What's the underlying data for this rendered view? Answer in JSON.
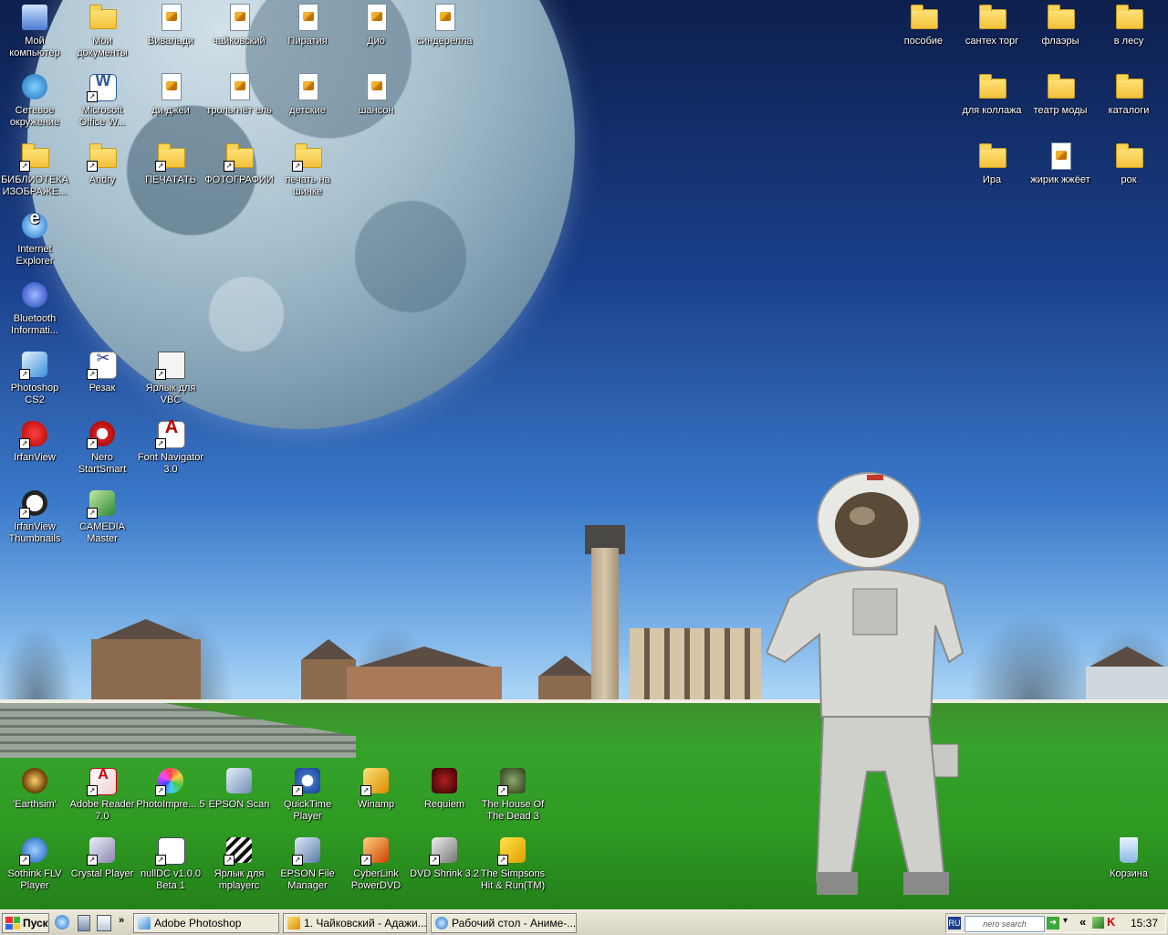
{
  "desktop": {
    "icons": {
      "my_computer": "Мой компьютер",
      "my_documents": "Мои документы",
      "vivaldi": "Вивальди",
      "tchaikovsky": "чайковский",
      "piratia": "Пиратия",
      "dio": "Дио",
      "cinderella": "синдерелла",
      "network": "Сетевое окружение",
      "msoffice": "Microsoft Office W...",
      "djs": "ди джеи",
      "trolgnet": "трольгнёт ель",
      "kids": "детские",
      "chanson": "шансон",
      "library": "БИБЛИОТЕКА ИЗОБРАЖЕ...",
      "andry": "Andry",
      "print": "ПЕЧАТАТЬ",
      "photos": "ФОТОГРАФИИ",
      "print_tire": "печать на шинке",
      "ie": "Internet Explorer",
      "bluetooth": "Bluetooth Informati...",
      "photoshop": "Photoshop CS2",
      "rezak": "Резак",
      "vbc": "Ярлык для VBC",
      "irfanview": "IrfanView",
      "nero": "Nero StartSmart",
      "fontnav": "Font Navigator 3.0",
      "irfan_thumbs": "IrfanView Thumbnails",
      "camedia": "CAMEDIA Master",
      "posobie": "пособие",
      "santeh": "сантех торг",
      "flyers": "флаэры",
      "forest": "в лесу",
      "collage": "для коллажа",
      "fashion": "театр моды",
      "catalogs": "каталоги",
      "ira": "Ира",
      "zhirik": "жирик жжёет",
      "rock": "рок",
      "earthsim": "'Earthsim'",
      "adobe_reader": "Adobe Reader 7.0",
      "photoimpression": "PhotoImpre... 5",
      "epson_scan": "EPSON Scan",
      "quicktime": "QuickTime Player",
      "winamp": "Winamp",
      "requiem": "Requiem",
      "house_dead": "The House Of The Dead 3",
      "sothink": "Sothink FLV Player",
      "crystal": "Crystal Player",
      "nulldc": "nullDC v1.0.0 Beta 1",
      "mplayer": "Ярлык для mplayerc",
      "epson_file": "EPSON File Manager",
      "powerdvd": "CyberLink PowerDVD",
      "dvdshrink": "DVD Shrink 3.2",
      "simpsons": "The Simpsons Hit & Run(TM)",
      "recycle": "Корзина"
    }
  },
  "taskbar": {
    "start_label": "Пуск",
    "tasks": [
      "Adobe Photoshop",
      "1. Чайковский - Адажи...",
      "Рабочий стол - Аниме-..."
    ],
    "tray": {
      "lang": "RU",
      "search_brand": "nero search",
      "clock": "15:37"
    }
  }
}
